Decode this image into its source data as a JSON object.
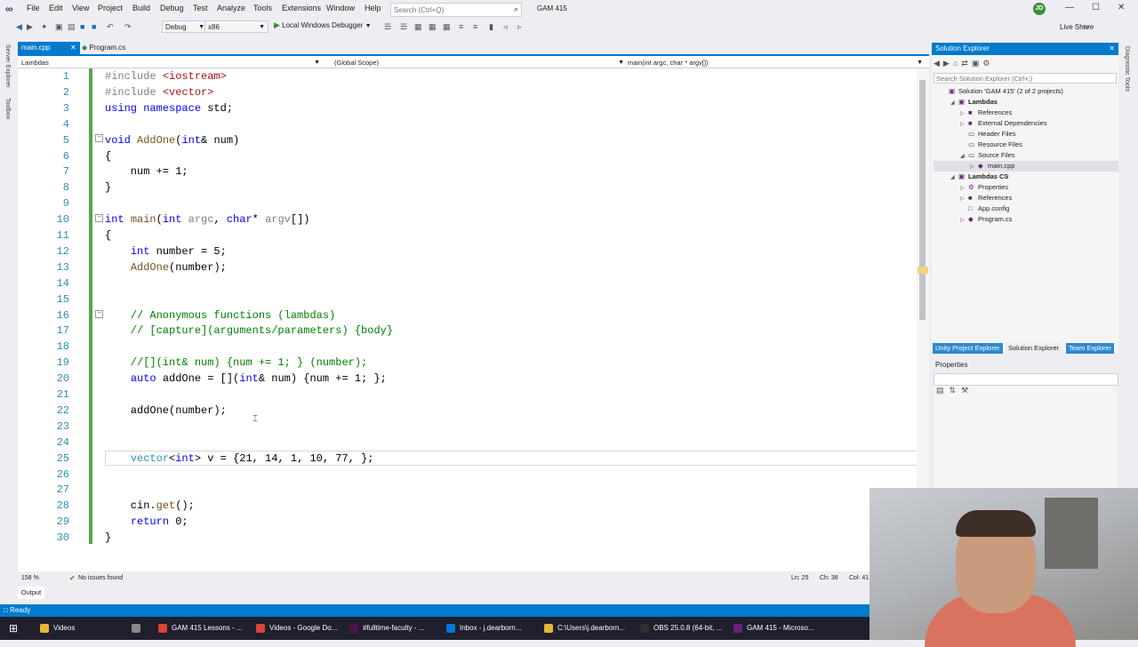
{
  "menubar": {
    "items": [
      "File",
      "Edit",
      "View",
      "Project",
      "Build",
      "Debug",
      "Test",
      "Analyze",
      "Tools",
      "Extensions",
      "Window",
      "Help"
    ],
    "search_placeholder": "Search (Ctrl+Q)",
    "solution_name": "GAM 415",
    "avatar_initials": "JD"
  },
  "toolbar": {
    "config": "Debug",
    "platform": "x86",
    "run_label": "Local Windows Debugger",
    "live_share": "Live Share"
  },
  "left_strip": [
    "Server Explorer",
    "Toolbox"
  ],
  "right_strip": "Diagnostic Tools",
  "editor": {
    "tabs": [
      {
        "label": "main.cpp",
        "active": true
      },
      {
        "label": "Program.cs",
        "active": false
      }
    ],
    "nav": {
      "project": "Lambdas",
      "scope": "(Global Scope)",
      "member": "main(int argc, char * argv[])"
    },
    "lines": [
      {
        "n": "1",
        "text": "#include <iostream>"
      },
      {
        "n": "2",
        "text": "#include <vector>"
      },
      {
        "n": "3",
        "text": "using namespace std;"
      },
      {
        "n": "4",
        "text": ""
      },
      {
        "n": "5",
        "text": "void AddOne(int& num)"
      },
      {
        "n": "6",
        "text": "{"
      },
      {
        "n": "7",
        "text": "    num += 1;"
      },
      {
        "n": "8",
        "text": "}"
      },
      {
        "n": "9",
        "text": ""
      },
      {
        "n": "10",
        "text": "int main(int argc, char* argv[])"
      },
      {
        "n": "11",
        "text": "{"
      },
      {
        "n": "12",
        "text": "    int number = 5;"
      },
      {
        "n": "13",
        "text": "    AddOne(number);"
      },
      {
        "n": "14",
        "text": ""
      },
      {
        "n": "15",
        "text": ""
      },
      {
        "n": "16",
        "text": "    // Anonymous functions (lambdas)"
      },
      {
        "n": "17",
        "text": "    // [capture](arguments/parameters) {body}"
      },
      {
        "n": "18",
        "text": ""
      },
      {
        "n": "19",
        "text": "    //[](int& num) {num += 1; } (number);"
      },
      {
        "n": "20",
        "text": "    auto addOne = [](int& num) {num += 1; };"
      },
      {
        "n": "21",
        "text": ""
      },
      {
        "n": "22",
        "text": "    addOne(number);"
      },
      {
        "n": "23",
        "text": ""
      },
      {
        "n": "24",
        "text": ""
      },
      {
        "n": "25",
        "text": "    vector<int> v = {21, 14, 1, 10, 77, };"
      },
      {
        "n": "26",
        "text": ""
      },
      {
        "n": "27",
        "text": ""
      },
      {
        "n": "28",
        "text": "    cin.get();"
      },
      {
        "n": "29",
        "text": "    return 0;"
      },
      {
        "n": "30",
        "text": "}"
      }
    ],
    "zoom": "158 %",
    "issues": "No issues found",
    "cursor_line": "Ln: 25",
    "cursor_col": "Ch: 38",
    "col_label": "Col: 41"
  },
  "output_tab": "Output",
  "solution_explorer": {
    "title": "Solution Explorer",
    "search_placeholder": "Search Solution Explorer (Ctrl+;)",
    "tree": [
      {
        "label": "Solution 'GAM 415' (2 of 2 projects)",
        "depth": 0
      },
      {
        "label": "Lambdas",
        "depth": 1
      },
      {
        "label": "References",
        "depth": 2
      },
      {
        "label": "External Dependencies",
        "depth": 2
      },
      {
        "label": "Header Files",
        "depth": 2
      },
      {
        "label": "Resource Files",
        "depth": 2
      },
      {
        "label": "Source Files",
        "depth": 2
      },
      {
        "label": "main.cpp",
        "depth": 3
      },
      {
        "label": "Lambdas CS",
        "depth": 1
      },
      {
        "label": "Properties",
        "depth": 2
      },
      {
        "label": "References",
        "depth": 2
      },
      {
        "label": "App.config",
        "depth": 2
      },
      {
        "label": "Program.cs",
        "depth": 2
      }
    ],
    "panel_tabs": [
      "Unity Project Explorer",
      "Solution Explorer",
      "Team Explorer"
    ]
  },
  "properties": {
    "title": "Properties"
  },
  "status": {
    "ready": "Ready"
  },
  "taskbar": [
    {
      "label": "Videos",
      "color": "#e8b339"
    },
    {
      "label": "",
      "color": "#888888"
    },
    {
      "label": "GAM 415 Lessons - ...",
      "color": "#db4437"
    },
    {
      "label": "Videos - Google Do...",
      "color": "#db4437"
    },
    {
      "label": "#fulltime-faculty - ...",
      "color": "#4a154b"
    },
    {
      "label": "Inbox - j.dearborn...",
      "color": "#0078d4"
    },
    {
      "label": "C:\\Users\\j.dearborn...",
      "color": "#e8b339"
    },
    {
      "label": "OBS 25.0.8 (64-bit, ...",
      "color": "#302e31"
    },
    {
      "label": "GAM 415 - Microso...",
      "color": "#68217a"
    }
  ],
  "colors": {
    "accent": "#007acc",
    "keyword": "#0000ff",
    "comment": "#008000",
    "type": "#2b91af",
    "string": "#a31515",
    "preprocessor": "#808080",
    "param": "#808080"
  }
}
